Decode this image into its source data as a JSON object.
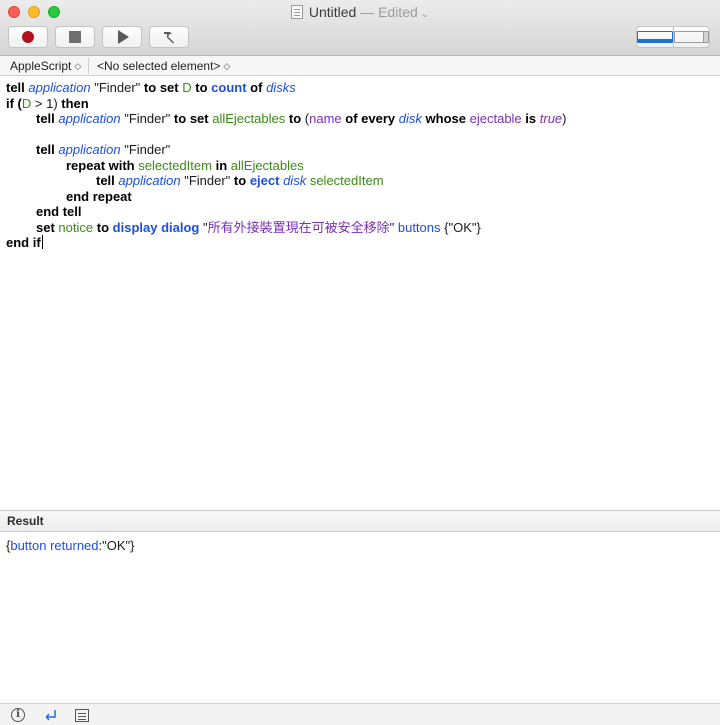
{
  "window": {
    "title": "Untitled",
    "edited": "— Edited",
    "chevron": "⌄"
  },
  "toolbar": {
    "record": "record-button",
    "stop": "stop-button",
    "run": "run-button",
    "compile": "compile-button"
  },
  "navbar": {
    "language": "AppleScript",
    "element": "<No selected element>",
    "updown": "◇"
  },
  "code": {
    "l1": [
      "tell",
      "application",
      "\"Finder\"",
      "to",
      "set",
      "D",
      "to",
      "count",
      "of",
      "disks"
    ],
    "l2": [
      "if (",
      "D",
      " > 1) ",
      "then"
    ],
    "l3": [
      "tell",
      "application",
      "\"Finder\"",
      "to",
      "set",
      "allEjectables",
      "to",
      "(",
      "name",
      "of",
      "every",
      "disk",
      "whose",
      "ejectable",
      "is",
      "true",
      ")"
    ],
    "l5": [
      "tell",
      "application",
      "\"Finder\""
    ],
    "l6": [
      "repeat with",
      "selectedItem",
      "in",
      "allEjectables"
    ],
    "l7": [
      "tell",
      "application",
      "\"Finder\"",
      "to",
      "eject",
      "disk",
      "selectedItem"
    ],
    "l8": "end repeat",
    "l9": "end tell",
    "l10": [
      "set",
      "notice",
      "to",
      "display dialog",
      "\"",
      "所有外接裝置現在可被安全移除",
      "\"",
      "buttons",
      "{\"OK\"}"
    ],
    "l11": "end if"
  },
  "result": {
    "header": "Result",
    "open": "{",
    "key": "button returned",
    "rest": ":\"OK\"}"
  },
  "colors": {
    "keyword": "#000000",
    "application": "#1b4fe0",
    "variable": "#3c8a16",
    "property": "#7a2fb8",
    "record": "#b2121d"
  },
  "icons": [
    "info-icon",
    "return-icon",
    "list-icon"
  ]
}
